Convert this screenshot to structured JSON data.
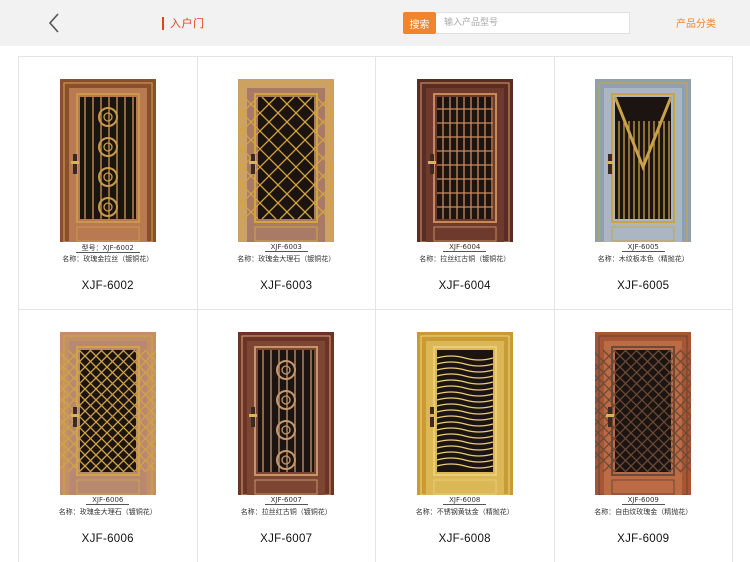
{
  "header": {
    "back_icon": "chevron-left-icon",
    "breadcrumb": "入户门",
    "search_button": "搜索",
    "search_placeholder": "输入产品型号",
    "category_link": "产品分类"
  },
  "products": [
    {
      "model_line": "型号：XJF-6002",
      "name_line": "名称：玫瑰金拉丝（镀铜花）",
      "code": "XJF-6002",
      "frame_color": "#8a4f2d",
      "panel_color": "#b97a52",
      "grill_color": "#c89a4a",
      "style": "ornament-bars"
    },
    {
      "model_line": "XJF-6003",
      "name_line": "名称：玫瑰金大理石（镀铜花）",
      "code": "XJF-6003",
      "frame_color": "#c9a169",
      "panel_color": "#a97a66",
      "grill_color": "#d4a53f",
      "style": "diamond-lattice"
    },
    {
      "model_line": "XJF-6004",
      "name_line": "名称：拉丝红古铜（镀铜花）",
      "code": "XJF-6004",
      "frame_color": "#5a2d24",
      "panel_color": "#6e3a2d",
      "grill_color": "#c88a5a",
      "style": "grid-bars"
    },
    {
      "model_line": "XJF-6005",
      "name_line": "名称：木纹板本色（精抛花）",
      "code": "XJF-6005",
      "frame_color": "#8fa0ae",
      "panel_color": "#aab6c2",
      "grill_color": "#c9a24a",
      "style": "chevron"
    },
    {
      "model_line": "XJF-6006",
      "name_line": "名称：玫瑰金大理石（镀铜花）",
      "code": "XJF-6006",
      "frame_color": "#c28f66",
      "panel_color": "#b88870",
      "grill_color": "#d0a447",
      "style": "diamond-fine"
    },
    {
      "model_line": "XJF-6007",
      "name_line": "名称：拉丝红古铜（镀铜花）",
      "code": "XJF-6007",
      "frame_color": "#6a3526",
      "panel_color": "#7d4632",
      "grill_color": "#c79668",
      "style": "ornament-scroll"
    },
    {
      "model_line": "XJF-6008",
      "name_line": "名称：不锈钢黄钛金（精抛花）",
      "code": "XJF-6008",
      "frame_color": "#c99b35",
      "panel_color": "#dbb755",
      "grill_color": "#eacd78",
      "style": "wave-bars"
    },
    {
      "model_line": "XJF-6009",
      "name_line": "名称：自由纹玫瑰金（精抛花）",
      "code": "XJF-6009",
      "frame_color": "#a65632",
      "panel_color": "#bd6b44",
      "grill_color": "#6a4a38",
      "style": "diamond-fine"
    }
  ]
}
